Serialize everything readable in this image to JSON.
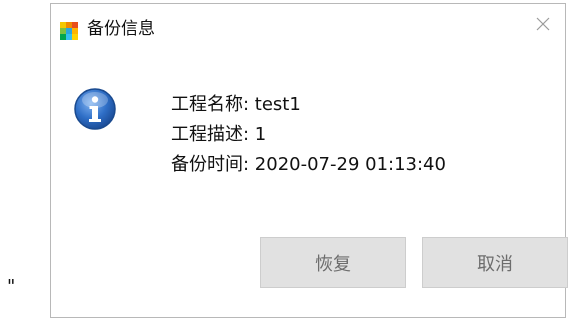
{
  "outside_text": "\"",
  "dialog": {
    "title": "备份信息",
    "icons": {
      "app": "app-tiles-icon",
      "close": "close-icon",
      "info": "info-icon"
    },
    "info_lines": [
      "工程名称: test1",
      "工程描述: 1",
      "备份时间: 2020-07-29 01:13:40"
    ],
    "buttons": {
      "restore": "恢复",
      "cancel": "取消"
    }
  },
  "colors": {
    "info_blue": "#2f6fc7",
    "button_bg": "#e1e1e1",
    "button_text": "#6d6d6d",
    "border": "#b8b8b8"
  }
}
